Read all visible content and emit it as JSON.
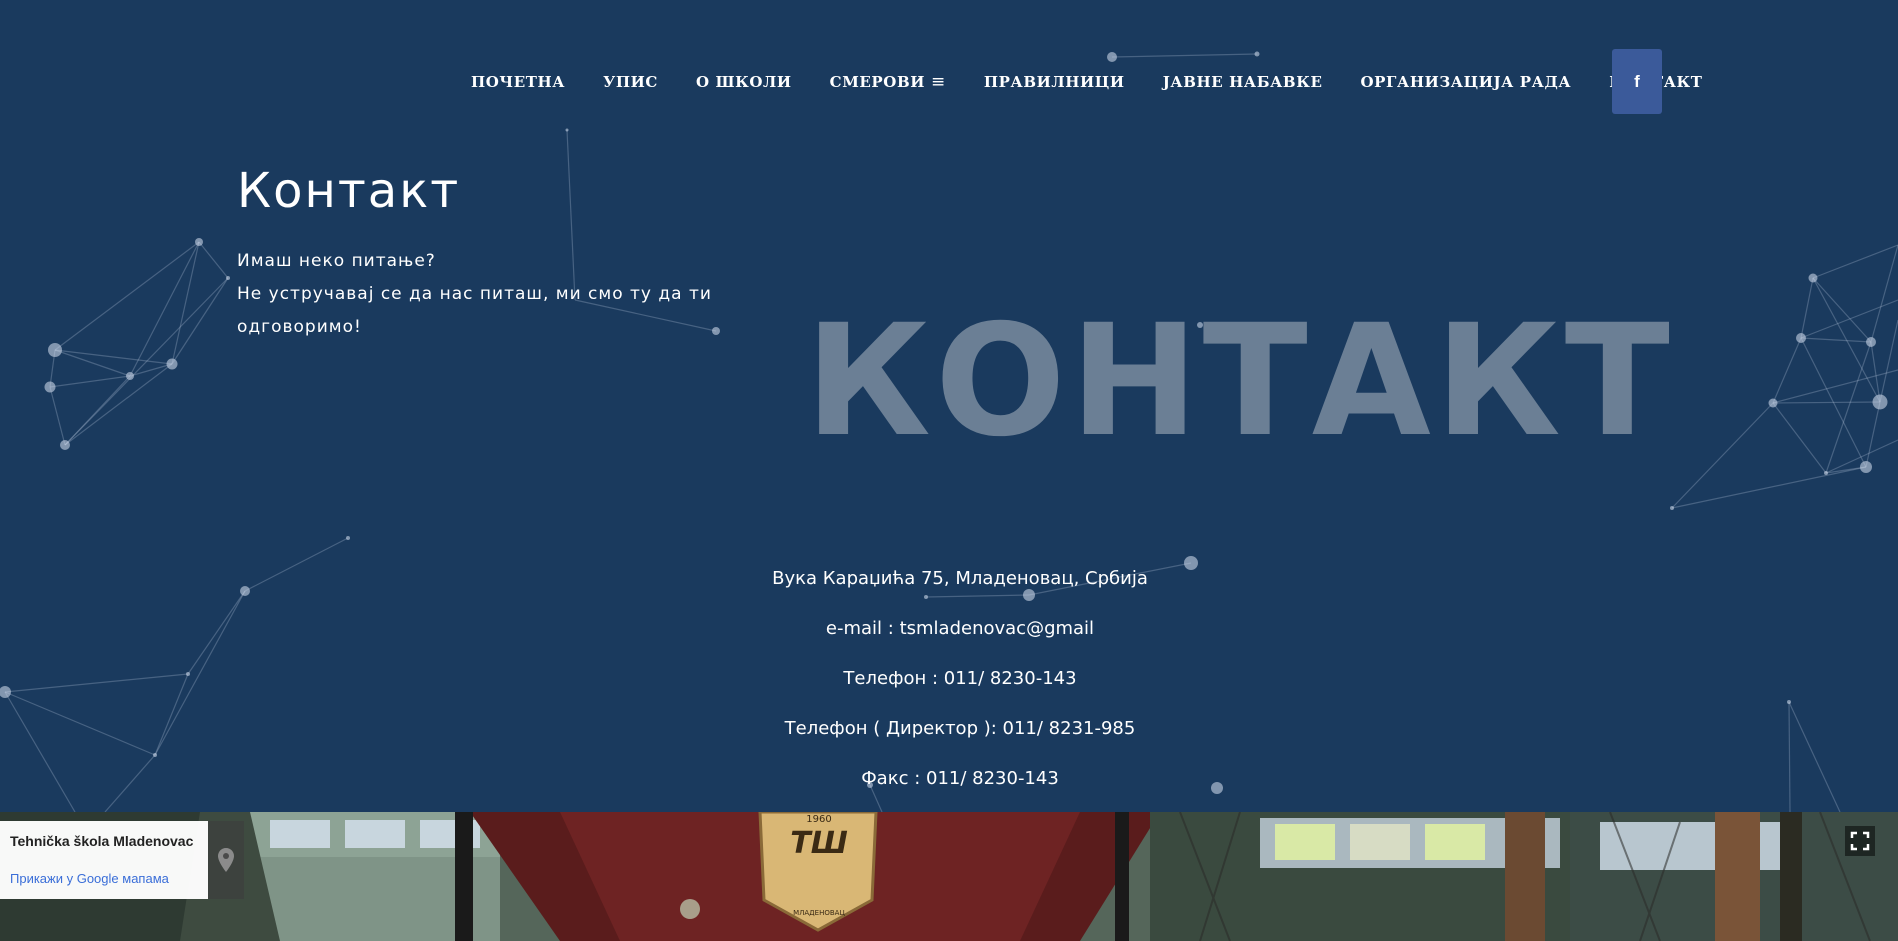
{
  "nav": {
    "items": [
      "ПОЧЕТНА",
      "УПИС",
      "О ШКОЛИ",
      "СМЕРОВИ",
      "ПРАВИЛНИЦИ",
      "ЈАВНЕ НАБАВКЕ",
      "ОРГАНИЗАЦИЈА РАДА",
      "КОНТАКТ"
    ],
    "facebook_label": "f"
  },
  "contact": {
    "title": "Контакт",
    "intro_line1": "Имаш неко питање?",
    "intro_line2": "Не устручавај се да нас питаш, ми смо ту да ти",
    "intro_line3": "одговоримо!",
    "background_text": "КОНТАКТ",
    "address": "Вука Караџића 75, Младеновац, Србија",
    "email": "e-mail : tsmladenovac@gmail",
    "phone": "Телефон : 011/ 8230-143",
    "phone_director": "Телефон ( Директор ): 011/ 8231-985",
    "fax": "Факс : 011/ 8230-143"
  },
  "map": {
    "place_name": "Tehnička škola Mladenovac",
    "link_text": "Прикажи у Google мапама",
    "badge_year": "1960",
    "badge_letters": "ТШ",
    "badge_city": "МЛАДЕНОВАЦ"
  },
  "icons": {
    "facebook": "facebook-icon",
    "menu": "hamburger-icon",
    "pin": "map-pin-icon",
    "fullscreen": "fullscreen-icon"
  },
  "colors": {
    "background": "#1a3a5e",
    "background_text": "#6b7f95",
    "facebook": "#3b5a9a",
    "map_link": "#3a6ed8"
  }
}
